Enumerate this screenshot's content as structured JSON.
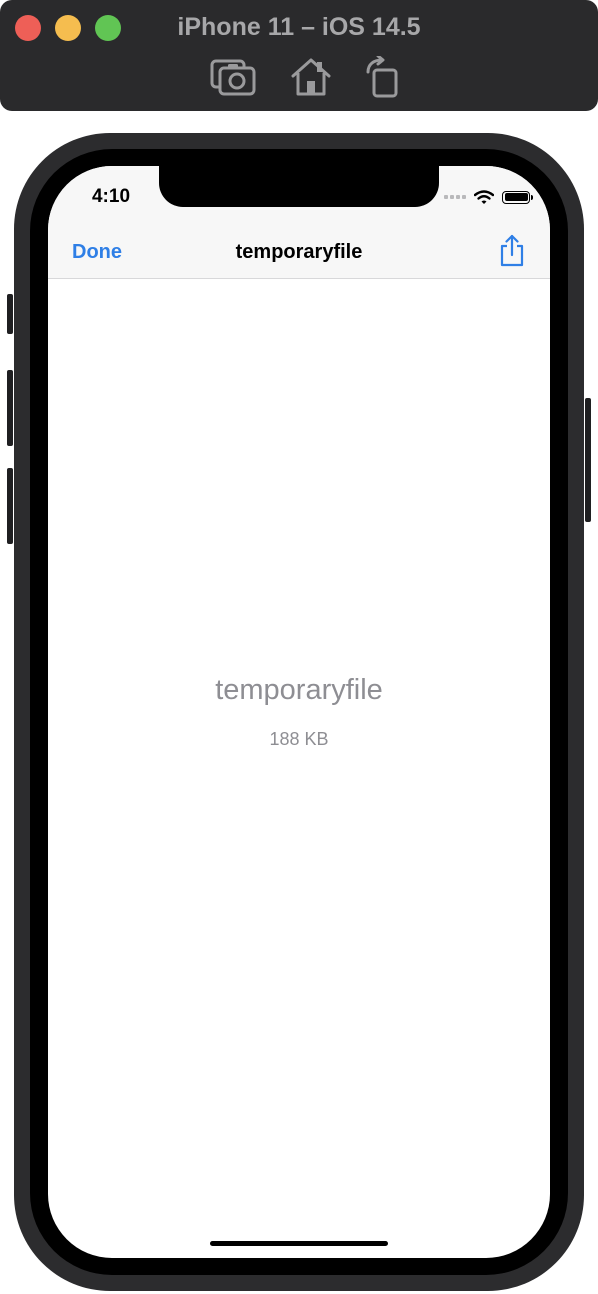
{
  "simulator": {
    "window_title": "iPhone 11 – iOS 14.5",
    "toolbar": {
      "screenshot_icon": "camera-screenshot-icon",
      "home_icon": "home-icon",
      "rotate_icon": "rotate-icon"
    }
  },
  "status_bar": {
    "time": "4:10"
  },
  "nav_bar": {
    "done_label": "Done",
    "title": "temporaryfile",
    "share_icon": "share-icon"
  },
  "preview": {
    "file_name": "temporaryfile",
    "file_size": "188 KB"
  },
  "colors": {
    "accent": "#2f7fe6",
    "secondary_text": "#8e8e93",
    "titlebar_bg": "#2a2a2c"
  }
}
